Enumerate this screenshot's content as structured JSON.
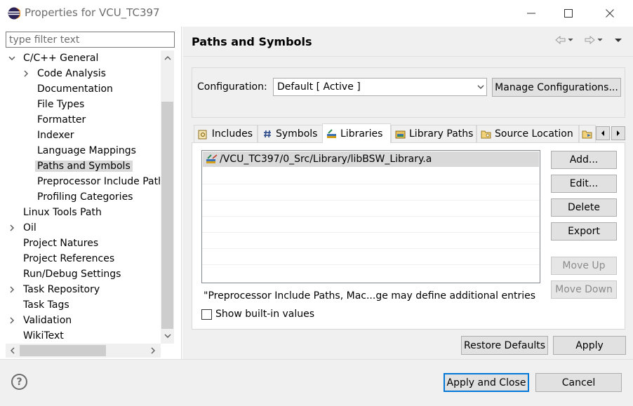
{
  "window": {
    "title": "Properties for VCU_TC397",
    "minimize": "—",
    "maximize": "☐",
    "close": "✕"
  },
  "filter": {
    "placeholder": "type filter text",
    "value": ""
  },
  "tree": {
    "items": [
      {
        "label": "C/C++ General",
        "twisty": "down"
      },
      {
        "label": "Code Analysis",
        "twisty": "right"
      },
      {
        "label": "Documentation"
      },
      {
        "label": "File Types"
      },
      {
        "label": "Formatter"
      },
      {
        "label": "Indexer"
      },
      {
        "label": "Language Mappings"
      },
      {
        "label": "Paths and Symbols",
        "selected": true
      },
      {
        "label": "Preprocessor Include Path"
      },
      {
        "label": "Profiling Categories"
      },
      {
        "label": "Linux Tools Path"
      },
      {
        "label": "Oil",
        "twisty": "right"
      },
      {
        "label": "Project Natures"
      },
      {
        "label": "Project References"
      },
      {
        "label": "Run/Debug Settings"
      },
      {
        "label": "Task Repository",
        "twisty": "right"
      },
      {
        "label": "Task Tags"
      },
      {
        "label": "Validation",
        "twisty": "right"
      },
      {
        "label": "WikiText"
      }
    ]
  },
  "page": {
    "title": "Paths and Symbols"
  },
  "config": {
    "label": "Configuration:",
    "selected": "Default  [ Active ]",
    "manage_label": "Manage Configurations..."
  },
  "tabs": [
    {
      "label": "Includes",
      "icon": "includes-icon"
    },
    {
      "label": "Symbols",
      "icon": "hash-icon"
    },
    {
      "label": "Libraries",
      "icon": "libraries-icon",
      "active": true
    },
    {
      "label": "Library Paths",
      "icon": "library-paths-icon"
    },
    {
      "label": "Source Location",
      "icon": "folder-icon"
    }
  ],
  "libraries": {
    "entries": [
      "/VCU_TC397/0_Src/Library/libBSW_Library.a"
    ],
    "note": "\"Preprocessor Include Paths, Mac...ge may define additional entries",
    "show_builtin_label": "Show built-in values",
    "show_builtin_checked": false
  },
  "side_buttons": {
    "add": "Add...",
    "edit": "Edit...",
    "delete": "Delete",
    "export": "Export",
    "move_up": "Move Up",
    "move_down": "Move Down"
  },
  "page_buttons": {
    "restore": "Restore Defaults",
    "apply": "Apply"
  },
  "dialog_buttons": {
    "apply_close": "Apply and Close",
    "cancel": "Cancel",
    "help": "?"
  },
  "colors": {
    "selection": "#d9d9d9",
    "focus": "#0078d7",
    "panel": "#f0f0f0"
  }
}
